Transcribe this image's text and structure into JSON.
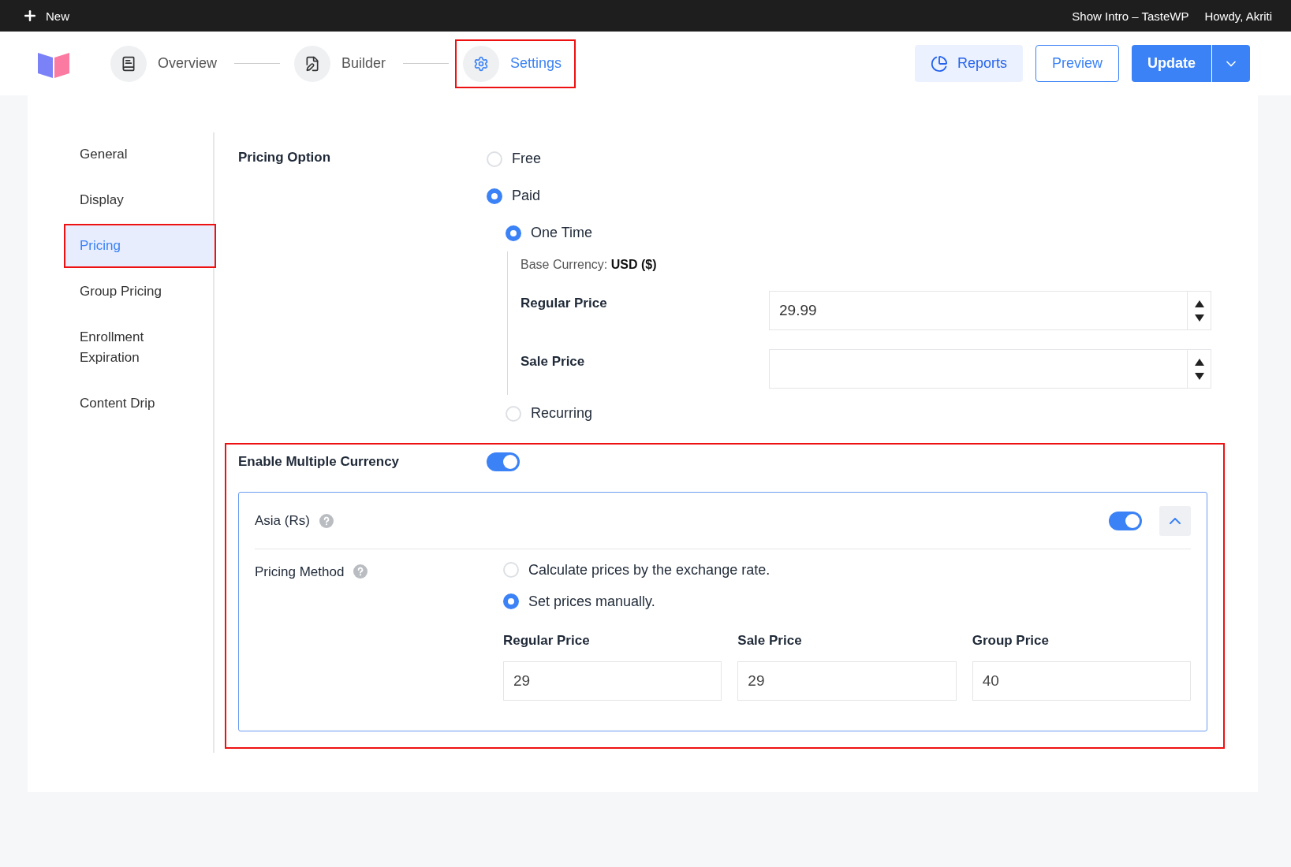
{
  "admin_bar": {
    "new_label": "New",
    "right": [
      "Show Intro – TasteWP",
      "Howdy, Akriti"
    ]
  },
  "steps": [
    {
      "kind": "overview",
      "label": "Overview",
      "selected": false,
      "highlighted": false
    },
    {
      "kind": "builder",
      "label": "Builder",
      "selected": false,
      "highlighted": false
    },
    {
      "kind": "settings",
      "label": "Settings",
      "selected": true,
      "highlighted": true
    }
  ],
  "actions": {
    "reports": "Reports",
    "preview": "Preview",
    "update": "Update"
  },
  "sidebar": [
    {
      "label": "General",
      "selected": false,
      "highlighted": false
    },
    {
      "label": "Display",
      "selected": false,
      "highlighted": false
    },
    {
      "label": "Pricing",
      "selected": true,
      "highlighted": true
    },
    {
      "label": "Group Pricing",
      "selected": false,
      "highlighted": false
    },
    {
      "label": "Enrollment Expiration",
      "selected": false,
      "highlighted": false
    },
    {
      "label": "Content Drip",
      "selected": false,
      "highlighted": false
    }
  ],
  "pricing": {
    "label": "Pricing Option",
    "options": [
      {
        "label": "Free",
        "selected": false
      },
      {
        "label": "Paid",
        "selected": true
      }
    ],
    "paid_types": [
      {
        "label": "One Time",
        "selected": true
      },
      {
        "label": "Recurring",
        "selected": false
      }
    ],
    "base_currency_label": "Base Currency:",
    "base_currency": "USD ($)",
    "fields": [
      {
        "label": "Regular Price",
        "value": "29.99"
      },
      {
        "label": "Sale Price"
      }
    ]
  },
  "multi_currency": {
    "label": "Enable Multiple Currency",
    "on": true,
    "highlighted": true,
    "regions": [
      {
        "name": "Asia (Rs)",
        "on": true,
        "expanded": true,
        "method_label": "Pricing Method",
        "methods": [
          {
            "label": "Calculate prices by the exchange rate.",
            "selected": false
          },
          {
            "label": "Set prices manually.",
            "selected": true
          }
        ],
        "prices": [
          {
            "label": "Regular Price",
            "value": "29"
          },
          {
            "label": "Sale Price",
            "value": "29"
          },
          {
            "label": "Group Price",
            "value": "40"
          }
        ]
      }
    ]
  }
}
